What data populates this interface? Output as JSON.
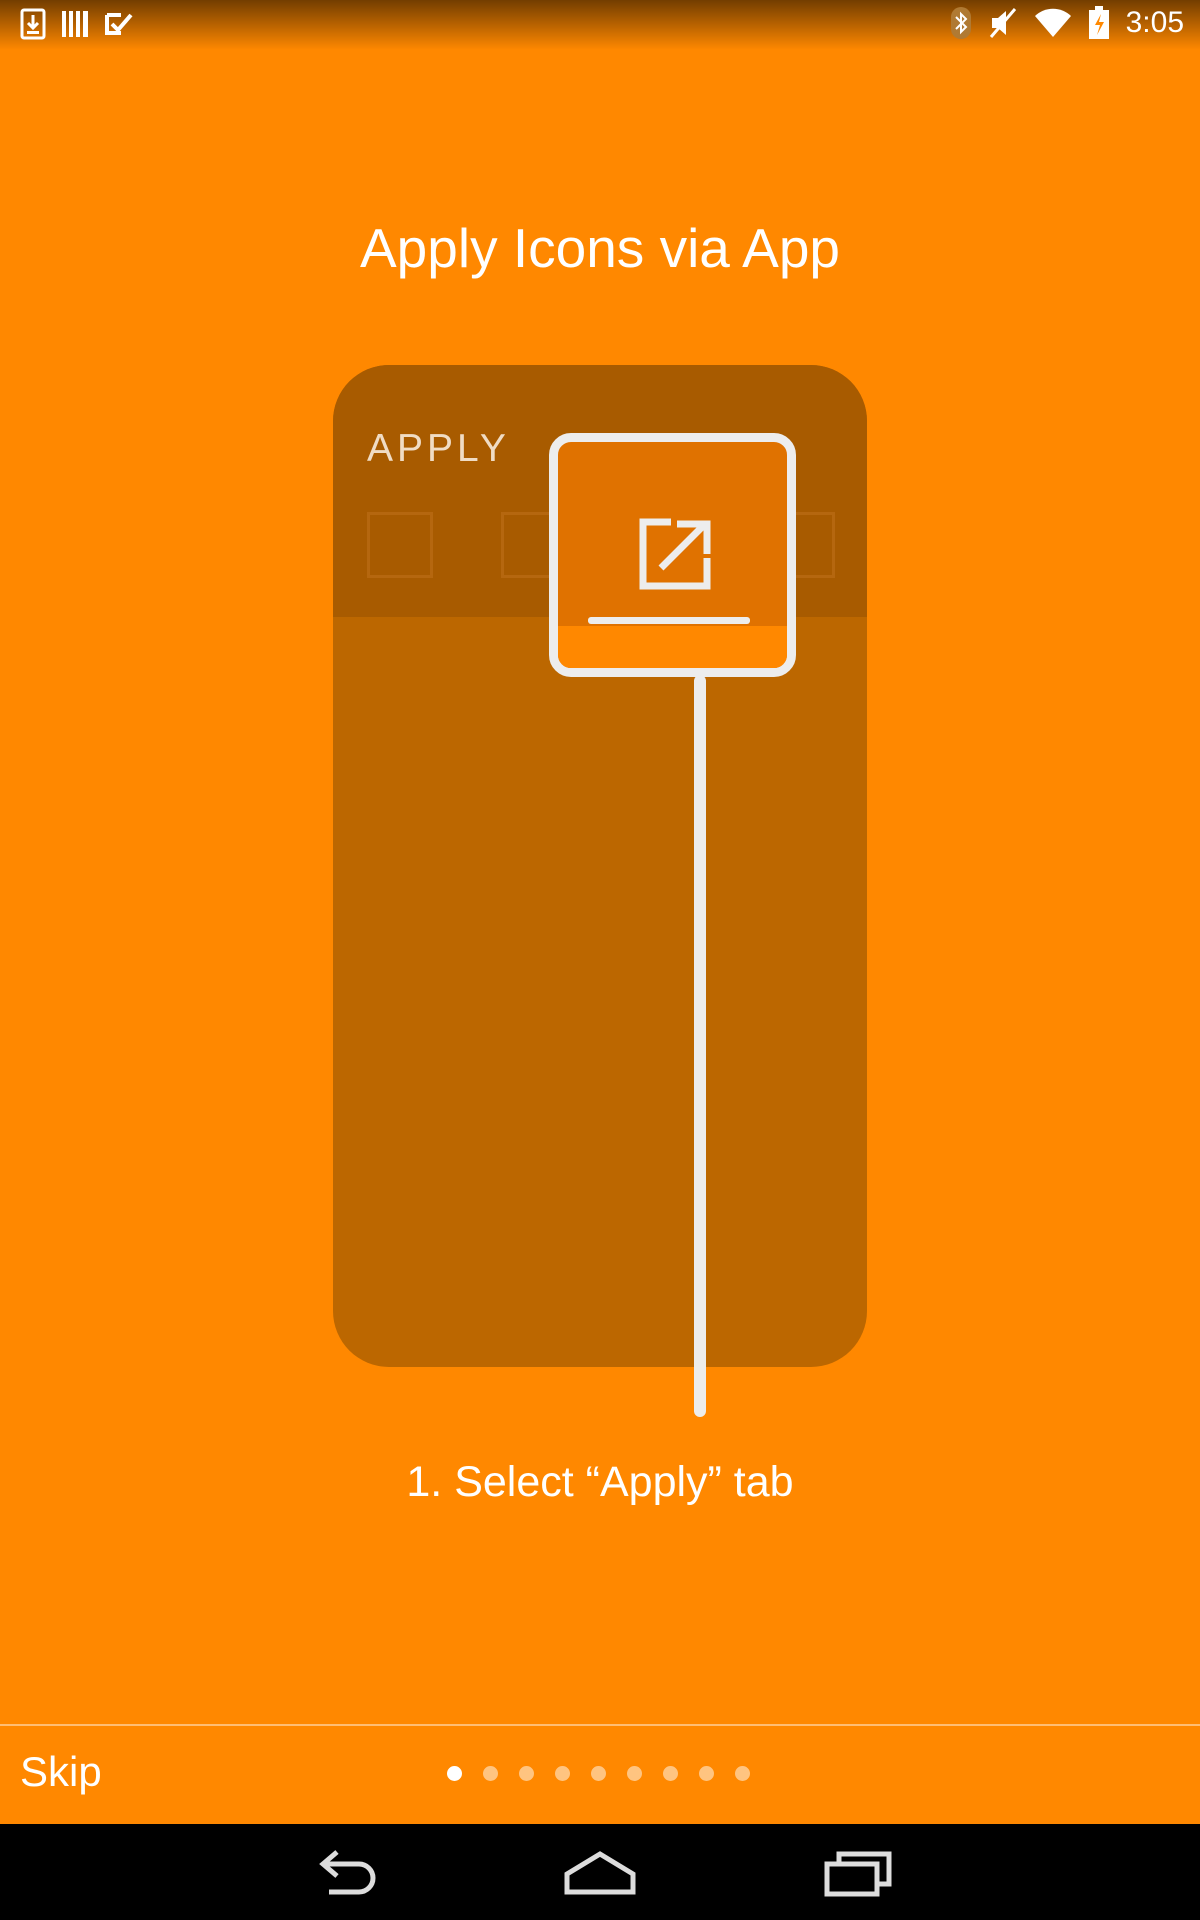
{
  "status_bar": {
    "time": "3:05",
    "left_icons": [
      "download-icon",
      "barcode-icon",
      "task-check-icon"
    ],
    "right_icons": [
      "bluetooth-icon",
      "mute-icon",
      "wifi-icon",
      "battery-charging-icon"
    ]
  },
  "page": {
    "title": "Apply Icons via App",
    "illustration": {
      "tab_label": "APPLY",
      "highlighted_icon": "open-external-icon"
    },
    "step_text": "1. Select “Apply” tab"
  },
  "footer": {
    "skip_label": "Skip",
    "page_count": 9,
    "active_page": 1
  },
  "navigation_bar": {
    "buttons": [
      "back-icon",
      "home-icon",
      "recents-icon"
    ]
  },
  "colors": {
    "background": "#FF8800",
    "card": "#BC6700",
    "card_header": "#A85B00",
    "highlight": "#EDEDED"
  }
}
